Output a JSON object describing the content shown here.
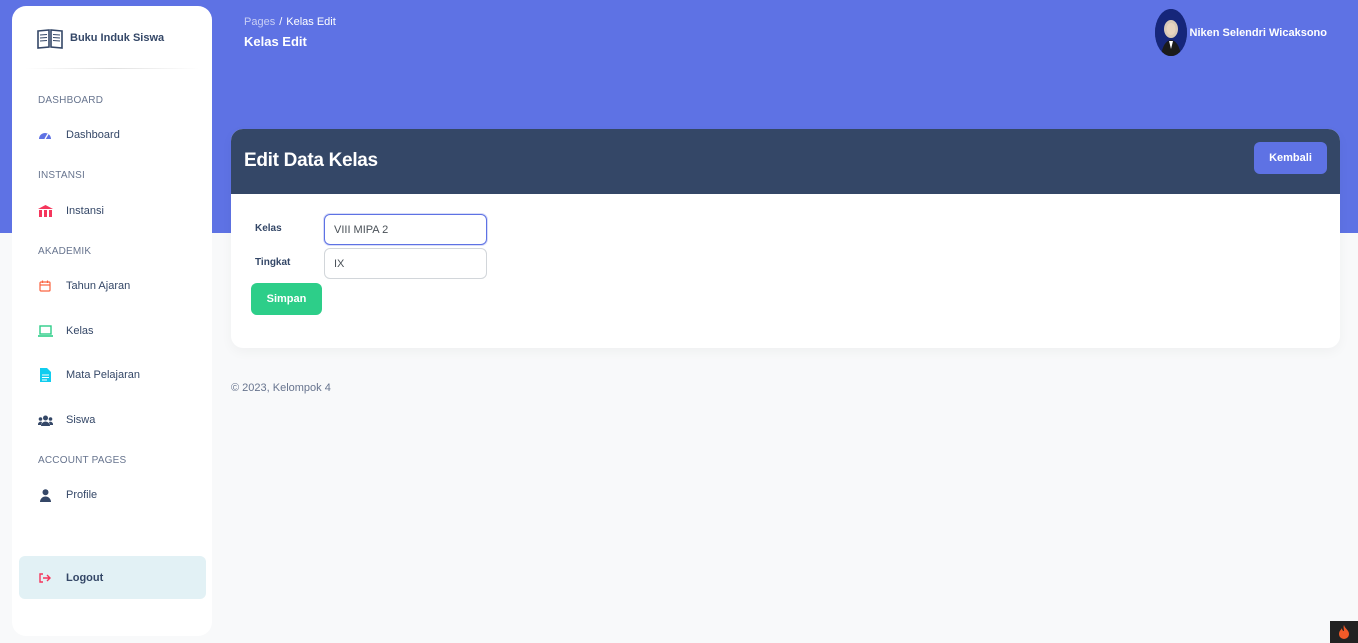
{
  "brand": {
    "name": "Buku Induk Siswa",
    "icon": "book-open-icon"
  },
  "sidebar": {
    "sections": {
      "dashboard": "DASHBOARD",
      "instansi": "INSTANSI",
      "akademik": "AKADEMIK",
      "account": "ACCOUNT PAGES"
    },
    "items": {
      "dashboard": {
        "label": "Dashboard",
        "icon": "gauge-icon",
        "color": "#5e72e4"
      },
      "instansi": {
        "label": "Instansi",
        "icon": "building-icon",
        "color": "#f5365c"
      },
      "tahun_ajaran": {
        "label": "Tahun Ajaran",
        "icon": "calendar-icon",
        "color": "#fb6340"
      },
      "kelas": {
        "label": "Kelas",
        "icon": "laptop-icon",
        "color": "#2dce89"
      },
      "mata_pelajaran": {
        "label": "Mata Pelajaran",
        "icon": "document-icon",
        "color": "#11cdef"
      },
      "siswa": {
        "label": "Siswa",
        "icon": "users-icon",
        "color": "#344767"
      },
      "profile": {
        "label": "Profile",
        "icon": "user-icon",
        "color": "#344767"
      }
    },
    "logout": {
      "label": "Logout",
      "icon": "sign-out-icon",
      "color": "#f5365c"
    }
  },
  "topbar": {
    "breadcrumb_parent": "Pages",
    "breadcrumb_separator": "/",
    "breadcrumb_current": "Kelas Edit",
    "page_title": "Kelas Edit",
    "user_name": "Niken Selendri Wicaksono"
  },
  "card": {
    "title": "Edit Data Kelas",
    "back_label": "Kembali",
    "fields": {
      "kelas": {
        "label": "Kelas",
        "value": "VIII MIPA 2"
      },
      "tingkat": {
        "label": "Tingkat",
        "value": "IX"
      }
    },
    "save_label": "Simpan"
  },
  "footer": {
    "text": "© 2023, Kelompok 4"
  },
  "colors": {
    "primary": "#5e72e4",
    "header_dark": "#344767",
    "success": "#2dce89",
    "logout_bg": "#e2f1f5"
  }
}
